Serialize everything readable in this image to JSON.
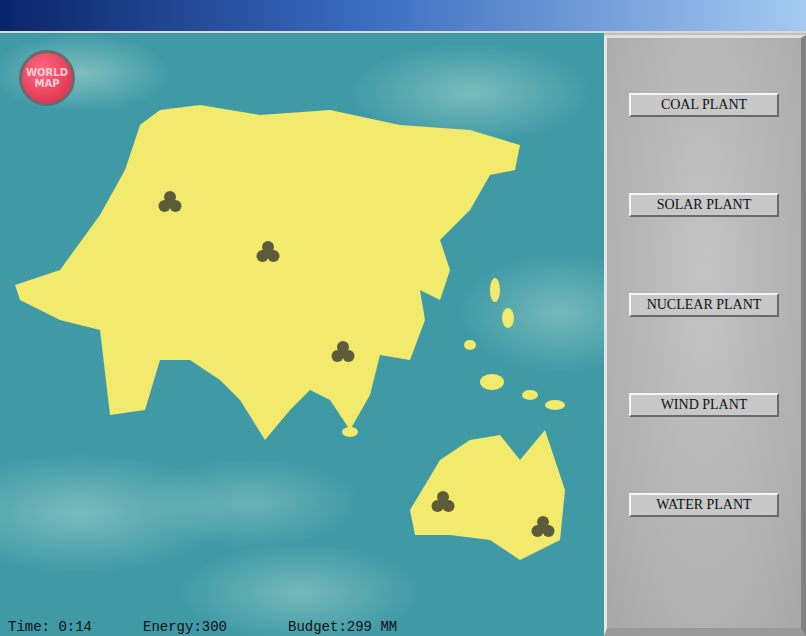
{
  "world_map_button": {
    "label": "WORLD MAP"
  },
  "buttons": [
    "COAL PLANT",
    "SOLAR PLANT",
    "NUCLEAR PLANT",
    "WIND PLANT",
    "WATER PLANT"
  ],
  "status_bar": {
    "time": "Time: 0:14",
    "energy": "Energy:300",
    "budget": "Budget:299 MM"
  }
}
